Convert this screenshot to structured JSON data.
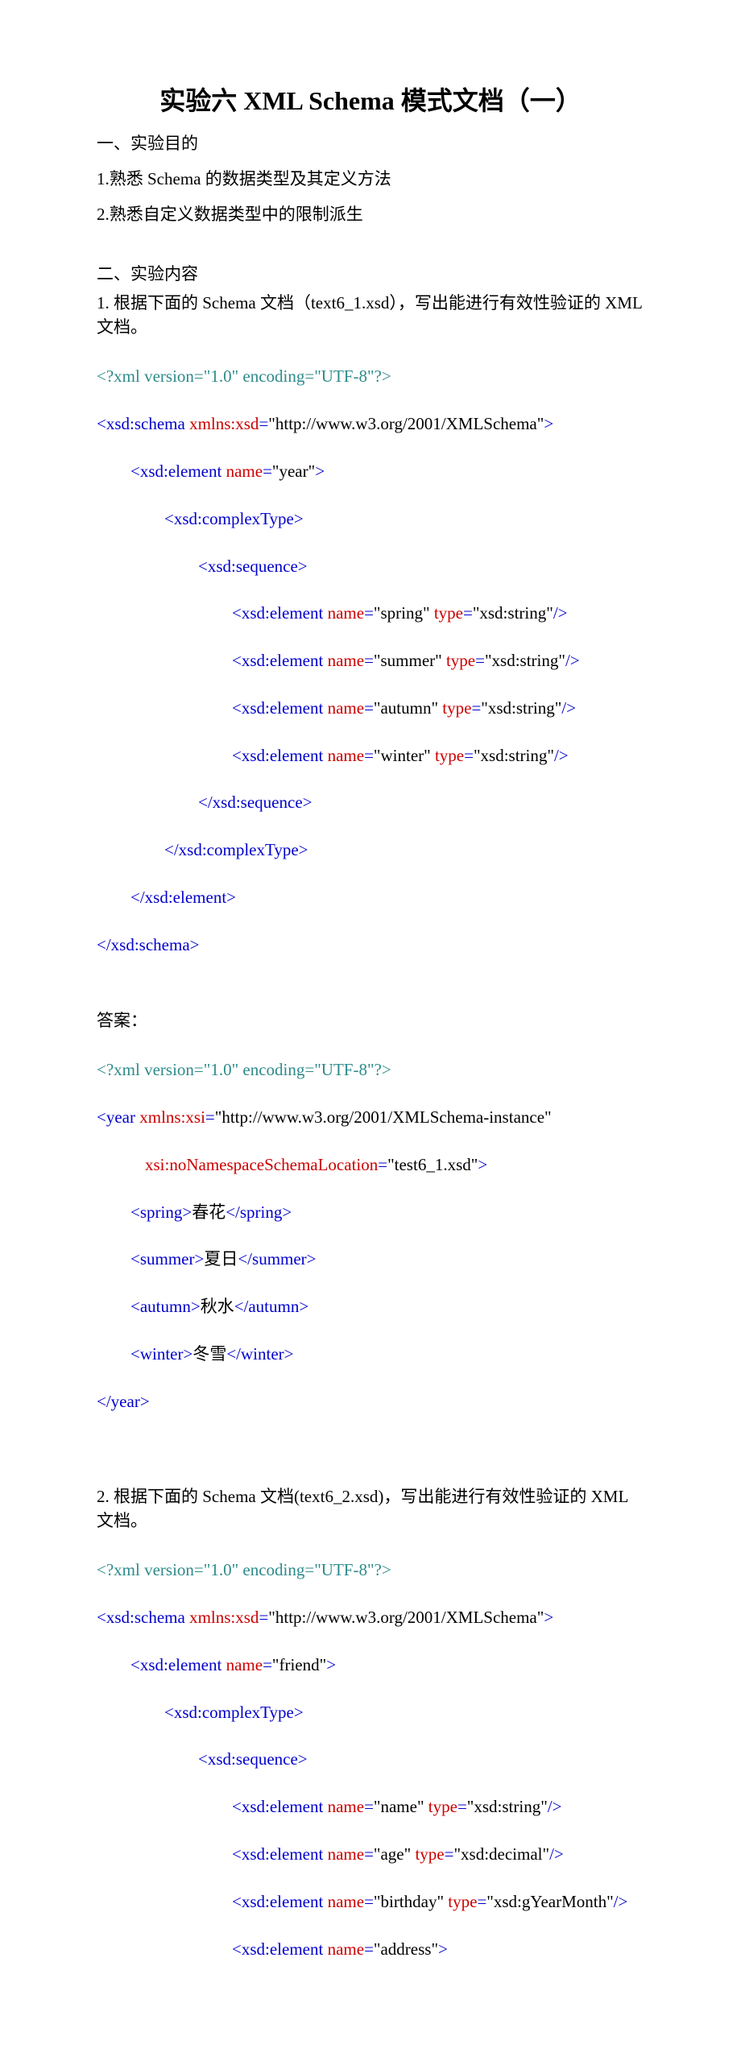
{
  "title": "实验六 XML Schema 模式文档（一）",
  "section1_heading": "一、实验目的",
  "objective1": "1.熟悉 Schema 的数据类型及其定义方法",
  "objective2": "2.熟悉自定义数据类型中的限制派生",
  "section2_heading": "二、实验内容",
  "q1_intro": "1. 根据下面的 Schema 文档（text6_1.xsd），写出能进行有效性验证的 XML 文档。",
  "s1": {
    "xml_decl_a": "<?xml version=",
    "xml_decl_b": "\"1.0\"",
    "xml_decl_c": " encoding=",
    "xml_decl_d": "\"UTF-8\"",
    "xml_decl_e": "?>",
    "schema_open_a": "<xsd:schema",
    "schema_open_b": " xmlns:xsd",
    "schema_open_c": "=",
    "schema_open_d": "\"http://www.w3.org/2001/XMLSchema\"",
    "schema_open_e": ">",
    "el_year_a": "<xsd:element",
    "el_year_b": " name",
    "el_year_c": "=",
    "el_year_d": "\"year\"",
    "el_year_e": ">",
    "ct_open": "<xsd:complexType>",
    "seq_open": "<xsd:sequence>",
    "el_attr_name": " name",
    "el_attr_type": " type",
    "eq": "=",
    "gt": ">",
    "slashgt": "/>",
    "spring_v": "\"spring\"",
    "summer_v": "\"summer\"",
    "autumn_v": "\"autumn\"",
    "winter_v": "\"winter\"",
    "xsdstring_v": "\"xsd:string\"",
    "seq_close": "</xsd:sequence>",
    "ct_close": "</xsd:complexType>",
    "el_close": "</xsd:element>",
    "schema_close": "</xsd:schema>"
  },
  "answer_label": "答案：",
  "a1": {
    "year_open_a": "<year",
    "year_open_b": " xmlns:xsi",
    "year_open_c": "=",
    "year_open_d": "\"http://www.w3.org/2001/XMLSchema-instance\"",
    "loc_a": "xsi:noNamespaceSchemaLocation",
    "loc_b": "=",
    "loc_c": "\"test6_1.xsd\"",
    "loc_d": ">",
    "spring_o": "<spring>",
    "spring_t": "春花",
    "spring_c": "</spring>",
    "summer_o": "<summer>",
    "summer_t": "夏日",
    "summer_c": "</summer>",
    "autumn_o": "<autumn>",
    "autumn_t": "秋水",
    "autumn_c": "</autumn>",
    "winter_o": "<winter>",
    "winter_t": "冬雪",
    "winter_c": "</winter>",
    "year_close": "</year>"
  },
  "q2_intro": "2. 根据下面的 Schema 文档(text6_2.xsd)，写出能进行有效性验证的 XML 文档。",
  "s2": {
    "friend_v": "\"friend\"",
    "name_v": "\"name\"",
    "age_v": "\"age\"",
    "birthday_v": "\"birthday\"",
    "address_v": "\"address\"",
    "xsddecimal_v": "\"xsd:decimal\"",
    "xsdgym_v": "\"xsd:gYearMonth\""
  }
}
